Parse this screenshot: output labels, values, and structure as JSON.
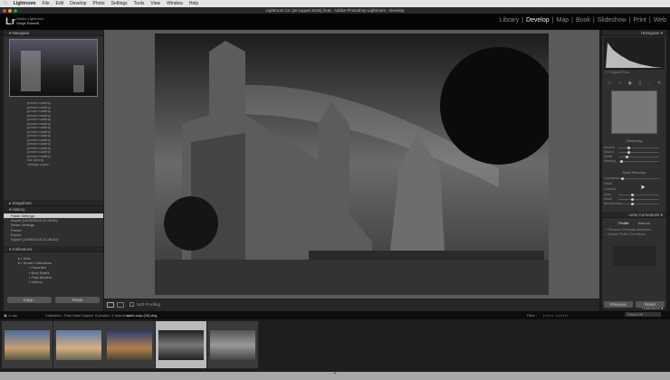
{
  "menubar": {
    "items": [
      "Lightroom",
      "File",
      "Edit",
      "Develop",
      "Photo",
      "Settings",
      "Tools",
      "View",
      "Window",
      "Help"
    ]
  },
  "window": {
    "title": "Lightroom CC (at August 2016).lrcat - Adobe Photoshop Lightroom - Develop"
  },
  "identity": {
    "logo": "Lr",
    "line1": "Adobe Lightroom",
    "line2": "Serge Ramelli"
  },
  "modules": [
    "Library",
    "Develop",
    "Map",
    "Book",
    "Slideshow",
    "Print",
    "Web"
  ],
  "active_module": "Develop",
  "left": {
    "navigator": "Navigator",
    "presets": [
      "preset roadtrip",
      "preset roadtrip",
      "preset roadtrip",
      "preset roadtrip",
      "preset roadtrip",
      "preset roadtrip",
      "preset roadtrip",
      "preset roadtrip",
      "preset roadtrip",
      "preset roadtrip",
      "preset roadtrip",
      "preset roadtrip",
      "preset roadtrip",
      "preset roadtrip",
      "hdr strong",
      "vintage sepia"
    ],
    "snapshots": "Snapshots",
    "history": "History",
    "history_items": [
      "Paste Settings",
      "Import (10/05/2016 22:46:00)",
      "Reset Settings",
      "Preset",
      "Export",
      "Export (10/05/2016 22:46:00)"
    ],
    "collections": "Collections",
    "collection_items": [
      "Sets",
      "Smart Collections",
      "Favorites",
      "Best Rated",
      "Past Months",
      "Videos",
      "Recently Modified"
    ],
    "copy": "Copy...",
    "paste": "Paste"
  },
  "toolbar": {
    "soft_proofing": "Soft Proofing"
  },
  "right": {
    "histogram": "Histogram",
    "original_photo": "Original Photo",
    "sharpening": "Sharpening",
    "sharpen_labels": [
      "Amount",
      "Radius",
      "Detail",
      "Masking"
    ],
    "noise": "Noise Reduction",
    "noise_labels": [
      "Luminance",
      "Detail",
      "Contrast",
      "Color",
      "Detail",
      "Smoothness"
    ],
    "lens": "Lens Corrections",
    "lens_tabs": [
      "Profile",
      "Manual"
    ],
    "lens_options": [
      "Remove Chromatic Aberration",
      "Enable Profile Corrections"
    ],
    "transform": "Transform",
    "previous": "Previous",
    "reset": "Reset"
  },
  "filmstrip": {
    "source": "Collection : Past Saint Sulpice",
    "count": "5 photos / 1 selected",
    "file": "saint-sulp-(16).dng",
    "filter": "Filter :",
    "filter_value": "Filters Off",
    "selected_index": 3
  },
  "colors": {
    "accent": "#cccccc",
    "panel": "#2f2f2f",
    "canvas": "#5a5a5a"
  }
}
